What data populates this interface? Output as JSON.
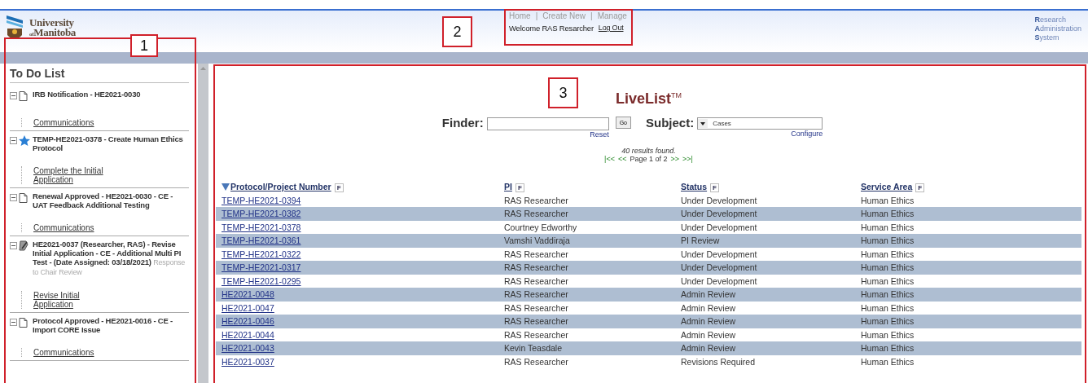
{
  "header": {
    "logo": {
      "line1": "University",
      "small": "of",
      "line2": "Manitoba"
    },
    "nav": {
      "items": [
        "Home",
        "Create New",
        "Manage"
      ],
      "separator": "|"
    },
    "welcome": "Welcome RAS Resarcher",
    "logout": "Log Out",
    "system_name": [
      "**R**esearch",
      "**A**dministration",
      "**S**ystem"
    ]
  },
  "todo": {
    "title": "To Do List",
    "items": [
      {
        "kind": "document",
        "expanded": true,
        "title": "IRB Notification - HE2021-0030",
        "link": "Communications"
      },
      {
        "kind": "star",
        "expanded": true,
        "title": "TEMP-HE2021-0378 - Create Human Ethics Protocol",
        "link": "Complete the Initial Application"
      },
      {
        "kind": "document",
        "expanded": true,
        "title": "Renewal Approved - HE2021-0030 - CE - UAT Feedback Additional Testing",
        "link": "Communications"
      },
      {
        "kind": "pen",
        "expanded": true,
        "title": "HE2021-0037 (Researcher, RAS) - Revise Initial Application - CE - Additional Multi PI Test - (Date Assigned: 03/18/2021)",
        "note": "Response to Chair Review",
        "link": "Revise Initial Application"
      },
      {
        "kind": "document",
        "expanded": true,
        "title": "Protocol Approved - HE2021-0016 - CE - Import CORE Issue",
        "link": "Communications"
      }
    ]
  },
  "livelist": {
    "title": "LiveList$^{TM}$",
    "finder_label": "Finder:",
    "go": "Go",
    "reset": "Reset",
    "subject_label": "Subject:",
    "subject_value": "Cases",
    "configure": "Configure",
    "results": "40 results found.",
    "pager": {
      "first": "|<<",
      "prev": "<<",
      "page": "Page 1 of 2",
      "next": ">>",
      "last": ">>|"
    },
    "table": {
      "columns": [
        {
          "label": "Protocol/Project Number",
          "sorted": true,
          "filter": "F"
        },
        {
          "label": "PI",
          "sorted": false,
          "filter": "F"
        },
        {
          "label": "Status",
          "sorted": false,
          "filter": "F"
        },
        {
          "label": "Service Area",
          "sorted": false,
          "filter": "F"
        }
      ],
      "rows": [
        [
          "TEMP-HE2021-0394",
          "RAS Researcher",
          "Under Development",
          "Human Ethics"
        ],
        [
          "TEMP-HE2021-0382",
          "RAS Researcher",
          "Under Development",
          "Human Ethics"
        ],
        [
          "TEMP-HE2021-0378",
          "Courtney Edworthy",
          "Under Development",
          "Human Ethics"
        ],
        [
          "TEMP-HE2021-0361",
          "Vamshi Vaddiraja",
          "PI Review",
          "Human Ethics"
        ],
        [
          "TEMP-HE2021-0322",
          "RAS Researcher",
          "Under Development",
          "Human Ethics"
        ],
        [
          "TEMP-HE2021-0317",
          "RAS Researcher",
          "Under Development",
          "Human Ethics"
        ],
        [
          "TEMP-HE2021-0295",
          "RAS Researcher",
          "Under Development",
          "Human Ethics"
        ],
        [
          "HE2021-0048",
          "RAS Researcher",
          "Admin Review",
          "Human Ethics"
        ],
        [
          "HE2021-0047",
          "RAS Researcher",
          "Admin Review",
          "Human Ethics"
        ],
        [
          "HE2021-0046",
          "RAS Researcher",
          "Admin Review",
          "Human Ethics"
        ],
        [
          "HE2021-0044",
          "RAS Researcher",
          "Admin Review",
          "Human Ethics"
        ],
        [
          "HE2021-0043",
          "Kevin Teasdale",
          "Admin Review",
          "Human Ethics"
        ],
        [
          "HE2021-0037",
          "RAS Researcher",
          "Revisions Required",
          "Human Ethics"
        ]
      ]
    }
  },
  "callouts": [
    {
      "number": "1"
    },
    {
      "number": "2"
    },
    {
      "number": "3"
    }
  ]
}
